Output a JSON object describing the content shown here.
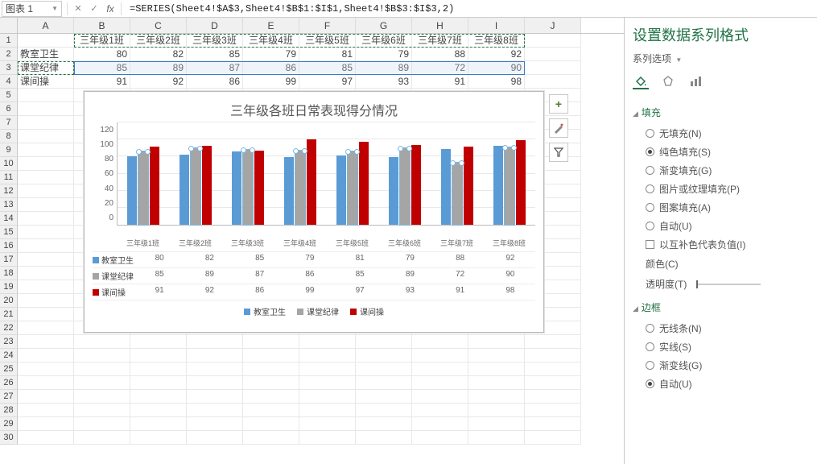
{
  "namebox": "图表 1",
  "formula": "=SERIES(Sheet4!$A$3,Sheet4!$B$1:$I$1,Sheet4!$B$3:$I$3,2)",
  "columns": [
    "A",
    "B",
    "C",
    "D",
    "E",
    "F",
    "G",
    "H",
    "I",
    "J"
  ],
  "row_headers": {
    "a": "教室卫生",
    "b": "课堂纪律",
    "c": "课间操"
  },
  "class_headers": [
    "三年级1班",
    "三年级2班",
    "三年级3班",
    "三年级4班",
    "三年级5班",
    "三年级6班",
    "三年级7班",
    "三年级8班"
  ],
  "sheet_values": {
    "r2": [
      80,
      82,
      85,
      79,
      81,
      79,
      88,
      92
    ],
    "r3": [
      85,
      89,
      87,
      86,
      85,
      89,
      72,
      90
    ],
    "r4": [
      91,
      92,
      86,
      99,
      97,
      93,
      91,
      98
    ]
  },
  "chart_data": {
    "type": "bar",
    "title": "三年级各班日常表现得分情况",
    "categories": [
      "三年级1班",
      "三年级2班",
      "三年级3班",
      "三年级4班",
      "三年级5班",
      "三年级6班",
      "三年级7班",
      "三年级8班"
    ],
    "series": [
      {
        "name": "教室卫生",
        "values": [
          80,
          82,
          85,
          79,
          81,
          79,
          88,
          92
        ],
        "color": "#5b9bd5"
      },
      {
        "name": "课堂纪律",
        "values": [
          85,
          89,
          87,
          86,
          85,
          89,
          72,
          90
        ],
        "color": "#a5a5a5"
      },
      {
        "name": "课间操",
        "values": [
          91,
          92,
          86,
          99,
          97,
          93,
          91,
          98
        ],
        "color": "#c00000"
      }
    ],
    "ylim": [
      0,
      120
    ],
    "yticks": [
      0,
      20,
      40,
      60,
      80,
      100,
      120
    ]
  },
  "panel": {
    "title": "设置数据系列格式",
    "series_options": "系列选项",
    "fill": {
      "header": "填充",
      "none": "无填充(N)",
      "solid": "纯色填充(S)",
      "gradient": "渐变填充(G)",
      "picture": "图片或纹理填充(P)",
      "pattern": "图案填充(A)",
      "auto": "自动(U)",
      "invert": "以互补色代表负值(I)",
      "color": "颜色(C)",
      "transparency": "透明度(T)"
    },
    "border": {
      "header": "边框",
      "none": "无线条(N)",
      "solid": "实线(S)",
      "gradient": "渐变线(G)",
      "auto": "自动(U)"
    }
  }
}
